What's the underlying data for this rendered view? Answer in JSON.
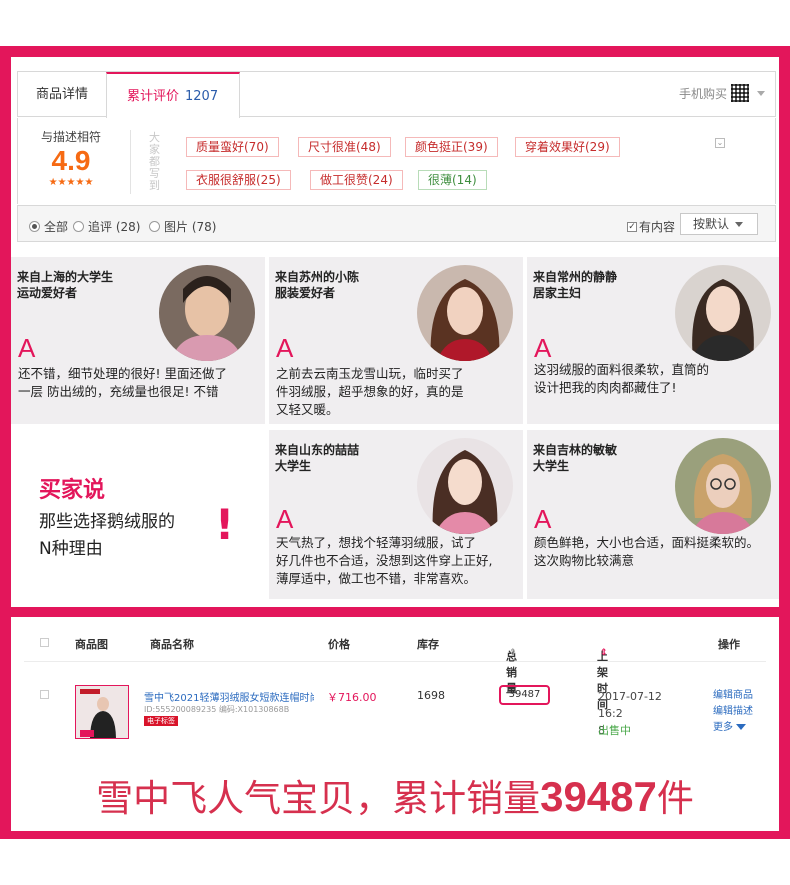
{
  "tabs": {
    "detail": "商品详情",
    "reviews": "累计评价",
    "review_count": "1207",
    "phone_buy": "手机购买"
  },
  "rating": {
    "label": "与描述相符",
    "score": "4.9",
    "stars": "★★★★★",
    "vert_label": "大家都写到",
    "tags": [
      {
        "text": "质量蛮好(70)",
        "tone": "red"
      },
      {
        "text": "尺寸很准(48)",
        "tone": "red"
      },
      {
        "text": "颜色挺正(39)",
        "tone": "red"
      },
      {
        "text": "穿着效果好(29)",
        "tone": "red"
      },
      {
        "text": "衣服很舒服(25)",
        "tone": "red"
      },
      {
        "text": "做工很赞(24)",
        "tone": "red"
      },
      {
        "text": "很薄(14)",
        "tone": "green"
      }
    ]
  },
  "filter": {
    "all": "全部",
    "follow": "追评 (28)",
    "images": "图片 (78)",
    "has_content": "有内容",
    "sort": "按默认"
  },
  "reviews": [
    {
      "who": "来自上海的大学生\n运动爱好者",
      "mark": "A",
      "quote": "还不错，细节处理的很好! 里面还做了\n一层 防出绒的，充绒量也很足! 不错"
    },
    {
      "who": "来自苏州的小陈\n服装爱好者",
      "mark": "A",
      "quote": "之前去云南玉龙雪山玩，临时买了\n件羽绒服，超乎想象的好，真的是\n又轻又暖。"
    },
    {
      "who": "来自常州的静静\n居家主妇",
      "mark": "A",
      "quote": "这羽绒服的面料很柔软，直筒的\n设计把我的肉肉都藏住了!"
    },
    {
      "who": "来自山东的喆喆\n大学生",
      "mark": "A",
      "quote": "天气热了，想找个轻薄羽绒服，试了\n好几件也不合适，没想到这件穿上正好,\n薄厚适中，做工也不错，非常喜欢。"
    },
    {
      "who": "来自吉林的敏敏\n大学生",
      "mark": "A",
      "quote": "颜色鲜艳，大小也合适，面料挺柔软的。\n这次购物比较满意"
    }
  ],
  "buyer_says": {
    "title": "买家说",
    "line1": "那些选择鹅绒服的",
    "line2": "N种理由",
    "bang": "!"
  },
  "table": {
    "headers": {
      "image": "商品图",
      "name": "商品名称",
      "price": "价格",
      "stock": "库存",
      "sold": "总销量",
      "listed": "上架时间",
      "ops": "操作"
    },
    "row": {
      "name": "雪中飞2021轻薄羽绒服女短款连帽时尚宽...",
      "id": "ID:555200089235 编码:X10130868B",
      "tag": "电子标签",
      "price": "￥716.00",
      "stock": "1698",
      "sold": "39487",
      "listed": "2017-07-12 16:2\n8",
      "status": "出售中",
      "op_edit": "编辑商品",
      "op_desc": "编辑描述",
      "op_more": "更多"
    }
  },
  "headline": {
    "pre": "雪中飞人气宝贝，累计销量",
    "num": "39487",
    "post": "件"
  },
  "colors": {
    "brand": "#e3165b",
    "score": "#f66a13",
    "link": "#2b6bbf"
  }
}
